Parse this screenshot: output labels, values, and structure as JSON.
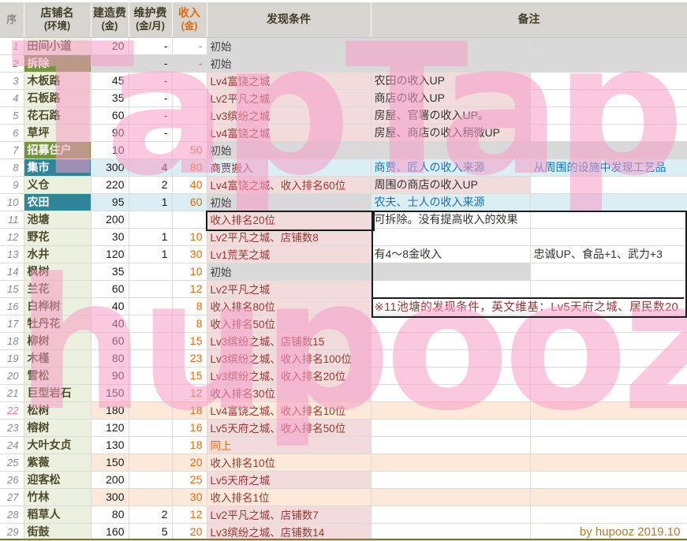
{
  "palette": {
    "header_bg": "#d7d5cf",
    "name_green": "#ebf1de",
    "name_dark_green": "#77933c",
    "name_teal": "#31859b",
    "row_cyan": "#daeef3",
    "cond_pink": "#f2dcdb",
    "row_orange": "#fde9d9",
    "row_gray": "#d9d9d9",
    "income_orange": "#e26b0a",
    "condition_maroon": "#953735",
    "remark_blue": "#1272bd",
    "credit_gold": "#ab7d2e",
    "watermark_pink": "#f59cc7",
    "box_black": "#1c1c1c"
  },
  "watermark": {
    "line1": "TapTap",
    "line2": "hupooz"
  },
  "table": {
    "headers": {
      "seq": "序",
      "name": {
        "l1": "店铺名",
        "l2": "(环境)"
      },
      "build": {
        "l1": "建造费",
        "l2": "(金)"
      },
      "maint": {
        "l1": "维护费",
        "l2": "(金/月)"
      },
      "income": {
        "l1": "收入",
        "l2": "(金)"
      },
      "condition": "发现条件",
      "remark": "备注"
    },
    "rows": [
      {
        "seq": "1",
        "name": "田间小道",
        "build": "20",
        "maint": "-",
        "income": "-",
        "condition": "初始",
        "remark1": "",
        "remark2": "",
        "style": {
          "cond": "gray",
          "condFg": "plain",
          "r1": "gray",
          "r2": "gray"
        }
      },
      {
        "seq": "2",
        "name": "拆除",
        "build": "",
        "maint": "-",
        "income": "-",
        "condition": "初始",
        "remark1": "",
        "remark2": "",
        "style": {
          "name": "dark",
          "cells": "gray",
          "cond": "gray",
          "condFg": "plain",
          "r1": "gray",
          "r2": "gray"
        }
      },
      {
        "seq": "3",
        "name": "木板路",
        "build": "45",
        "maint": "-",
        "income": "",
        "condition": "Lv4富饶之城",
        "remark1": "农田の收入UP",
        "remark2": "",
        "style": {
          "r1": "pink"
        }
      },
      {
        "seq": "4",
        "name": "石板路",
        "build": "35",
        "maint": "-",
        "income": "",
        "condition": "Lv2平凡之城",
        "remark1": "商店の收入UP",
        "remark2": "",
        "style": {
          "r1": "pink"
        }
      },
      {
        "seq": "5",
        "name": "花石路",
        "build": "60",
        "maint": "-",
        "income": "",
        "condition": "Lv3缤纷之城",
        "remark1": "房屋、官署の收入UP。",
        "remark2": "",
        "style": {
          "r1": "pink"
        }
      },
      {
        "seq": "6",
        "name": "草坪",
        "build": "90",
        "maint": "-",
        "income": "",
        "condition": "Lv4富饶之城",
        "remark1": "房屋、商店の收入稍微UP",
        "remark2": "",
        "style": {
          "r1": "pink"
        }
      },
      {
        "seq": "7",
        "name": "招募住户",
        "build": "10",
        "maint": "",
        "income": "50",
        "condition": "初始",
        "remark1": "",
        "remark2": "",
        "style": {
          "name": "dark",
          "cond": "gray",
          "condFg": "plain",
          "r1": "gray",
          "r2": "gray"
        }
      },
      {
        "seq": "8",
        "name": "集市",
        "build": "300",
        "maint": "4",
        "income": "80",
        "condition": "商贾搬入",
        "remark1": "商贾、匠人の收入来源",
        "remark2": "从周围的设施中发现工艺品",
        "style": {
          "name": "teal",
          "cells": "cyan",
          "cond": "cyan",
          "r1": "cyan",
          "r1Fg": "blue",
          "r2": "cyan",
          "r2Fg": "blue"
        }
      },
      {
        "seq": "9",
        "name": "义仓",
        "build": "220",
        "maint": "2",
        "income": "40",
        "condition": "Lv4富饶之城、收入排名60位",
        "remark1": "周围の商店の收入UP",
        "remark2": "",
        "style": {
          "r1": "pink"
        }
      },
      {
        "seq": "10",
        "name": "农田",
        "build": "95",
        "maint": "1",
        "income": "60",
        "condition": "初始",
        "remark1": "农夫、士人の收入来源",
        "remark2": "",
        "style": {
          "name": "teal",
          "cells": "cyan",
          "cond": "gray",
          "condFg": "plain",
          "r1": "cyan",
          "r1Fg": "blue",
          "r2": "cyan"
        }
      },
      {
        "seq": "11",
        "name": "池塘",
        "build": "200",
        "maint": "",
        "income": "",
        "condition": "收入排名20位",
        "remark1": "可拆除。没有提高收入的效果",
        "remark2": "",
        "style": {}
      },
      {
        "seq": "12",
        "name": "野花",
        "build": "30",
        "maint": "1",
        "income": "10",
        "condition": "Lv2平凡之城、店铺数8",
        "remark1": "",
        "remark2": "",
        "style": {}
      },
      {
        "seq": "13",
        "name": "水井",
        "build": "120",
        "maint": "1",
        "income": "30",
        "condition": "Lv1荒芜之城",
        "remark1": "有4～8金收入",
        "remark2": "忠诚UP、食品+1、武力+3",
        "style": {}
      },
      {
        "seq": "14",
        "name": "枫树",
        "build": "35",
        "maint": "",
        "income": "10",
        "condition": "初始",
        "remark1": "",
        "remark2": "",
        "style": {
          "cond": "gray",
          "condFg": "plain",
          "r1": "gray"
        }
      },
      {
        "seq": "15",
        "name": "兰花",
        "build": "60",
        "maint": "",
        "income": "12",
        "condition": "Lv2平凡之城",
        "remark1": "",
        "remark2": "",
        "style": {}
      },
      {
        "seq": "16",
        "name": "白桦树",
        "build": "40",
        "maint": "",
        "income": "8",
        "condition": "收入排名80位",
        "remark1": "※11池塘的发现条件，英文维基：Lv5天府之城、居民数20",
        "remark2": "",
        "note_span": true,
        "style": {
          "r1Fg": "maroon"
        }
      },
      {
        "seq": "17",
        "name": "牡丹花",
        "build": "40",
        "maint": "",
        "income": "8",
        "condition": "收入排名50位",
        "remark1": "",
        "remark2": "",
        "style": {}
      },
      {
        "seq": "18",
        "name": "柳树",
        "build": "60",
        "maint": "",
        "income": "15",
        "condition": "Lv3缤纷之城、店铺数15",
        "remark1": "",
        "remark2": "",
        "style": {}
      },
      {
        "seq": "19",
        "name": "木槿",
        "build": "80",
        "maint": "",
        "income": "23",
        "condition": "Lv3缤纷之城、收入排名100位",
        "remark1": "",
        "remark2": "",
        "style": {}
      },
      {
        "seq": "20",
        "name": "雪松",
        "build": "90",
        "maint": "",
        "income": "15",
        "condition": "Lv3缤纷之城、收入排名20位",
        "remark1": "",
        "remark2": "",
        "style": {}
      },
      {
        "seq": "21",
        "name": "巨型岩石",
        "build": "150",
        "maint": "",
        "income": "12",
        "condition": "收入排名30位",
        "remark1": "",
        "remark2": "",
        "style": {}
      },
      {
        "seq": "22",
        "name": "松树",
        "build": "180",
        "maint": "",
        "income": "18",
        "condition": "Lv4富饶之城、收入排名10位",
        "remark1": "",
        "remark2": "",
        "style": {
          "cells": "orange",
          "cond": "orange",
          "r1": "orange",
          "r2": "orange",
          "seqFg": "pink"
        }
      },
      {
        "seq": "23",
        "name": "榕树",
        "build": "120",
        "maint": "",
        "income": "16",
        "condition": "Lv5天府之城、收入排名50位",
        "remark1": "",
        "remark2": "",
        "style": {}
      },
      {
        "seq": "24",
        "name": "大叶女贞",
        "build": "130",
        "maint": "",
        "income": "18",
        "condition": "同上",
        "remark1": "",
        "remark2": "",
        "style": {
          "condFg": "orange"
        }
      },
      {
        "seq": "25",
        "name": "紫薇",
        "build": "150",
        "maint": "",
        "income": "20",
        "condition": "收入排名10位",
        "remark1": "",
        "remark2": "",
        "style": {
          "cells": "orange",
          "cond": "orange",
          "r1": "orange",
          "r2": "orange"
        }
      },
      {
        "seq": "26",
        "name": "迎客松",
        "build": "200",
        "maint": "",
        "income": "25",
        "condition": "Lv5天府之城",
        "remark1": "",
        "remark2": "",
        "style": {}
      },
      {
        "seq": "27",
        "name": "竹林",
        "build": "300",
        "maint": "",
        "income": "30",
        "condition": "收入排名1位",
        "remark1": "",
        "remark2": "",
        "style": {
          "cells": "orange",
          "cond": "orange",
          "r1": "orange",
          "r2": "orange"
        }
      },
      {
        "seq": "28",
        "name": "稻草人",
        "build": "80",
        "maint": "2",
        "income": "12",
        "condition": "Lv2平凡之城、店铺数7",
        "remark1": "",
        "remark2": "",
        "style": {}
      },
      {
        "seq": "29",
        "name": "街鼓",
        "build": "160",
        "maint": "5",
        "income": "20",
        "condition": "Lv3缤纷之城、店铺数14",
        "remark1": "",
        "remark2": "by hupooz 2019.10",
        "style": {
          "r2Fg": "credit"
        }
      }
    ]
  }
}
